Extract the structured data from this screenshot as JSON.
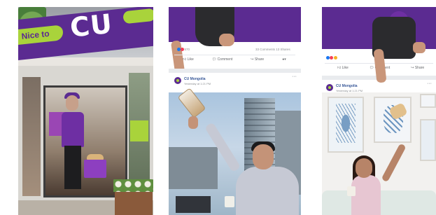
{
  "store": {
    "sign_text": "Nice to",
    "logo_text": "CU"
  },
  "post_left": {
    "reaction_count": "570",
    "comments_shares": "33 Comments  13 Shares",
    "actions": {
      "like": "Like",
      "comment": "Comment",
      "share": "Share"
    },
    "page_name": "CU Mongolia",
    "post_time": "Yesterday at 1:21 PM",
    "more": "···"
  },
  "post_right": {
    "reaction_count": "",
    "actions": {
      "like": "Like",
      "comment": "Comment",
      "share": "Share"
    },
    "page_name": "CU Mongolia",
    "post_time": "Yesterday at 1:21 PM",
    "more": "···"
  },
  "colors": {
    "brand_purple": "#5b2b91",
    "brand_lime": "#a9d33b",
    "facebook_blue": "#385898"
  }
}
